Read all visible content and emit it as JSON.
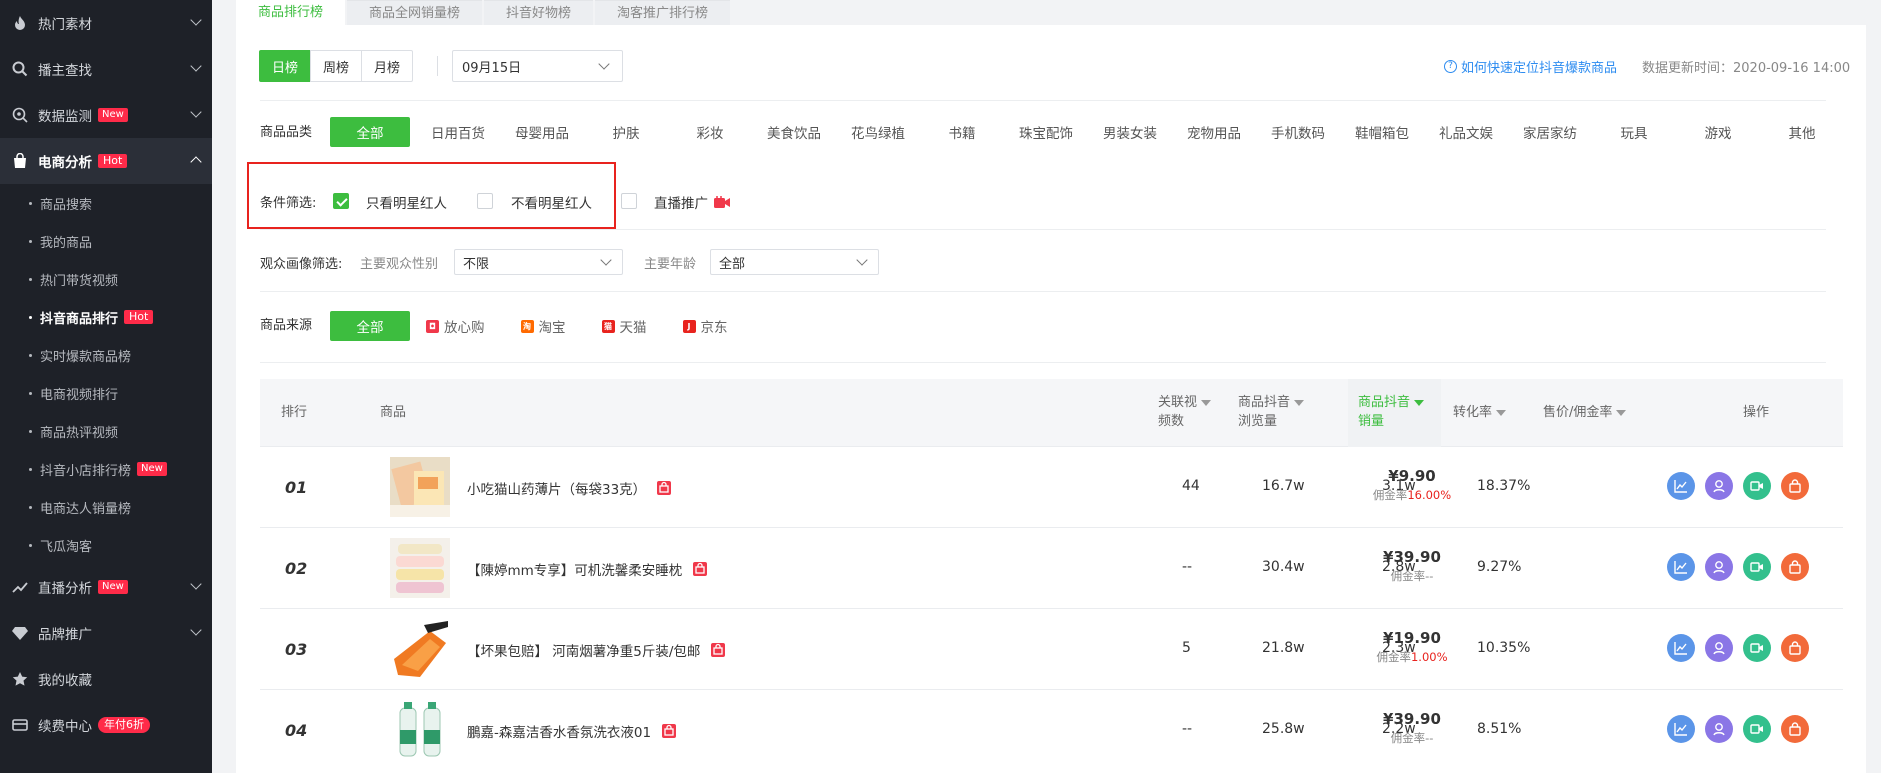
{
  "sidebar": {
    "items": [
      {
        "label": "热门素材",
        "icon": "fire-icon"
      },
      {
        "label": "播主查找",
        "icon": "search-icon"
      },
      {
        "label": "数据监测",
        "icon": "monitor-icon",
        "badge": "New"
      },
      {
        "label": "电商分析",
        "icon": "shopping-bag-icon",
        "badge": "Hot"
      },
      {
        "label": "直播分析",
        "icon": "trend-icon",
        "badge": "New"
      },
      {
        "label": "品牌推广",
        "icon": "diamond-icon"
      },
      {
        "label": "我的收藏",
        "icon": "star-icon"
      },
      {
        "label": "续费中心",
        "icon": "card-icon",
        "badge": "年付6折"
      }
    ],
    "sub_items": [
      {
        "label": "商品搜索"
      },
      {
        "label": "我的商品"
      },
      {
        "label": "热门带货视频"
      },
      {
        "label": "抖音商品排行",
        "badge": "Hot"
      },
      {
        "label": "实时爆款商品榜"
      },
      {
        "label": "电商视频排行"
      },
      {
        "label": "商品热评视频"
      },
      {
        "label": "抖音小店排行榜",
        "badge": "New"
      },
      {
        "label": "电商达人销量榜"
      },
      {
        "label": "飞瓜淘客"
      }
    ]
  },
  "tabs": [
    "商品排行榜",
    "商品全网销量榜",
    "抖音好物榜",
    "淘客推广排行榜"
  ],
  "period_buttons": [
    "日榜",
    "周榜",
    "月榜"
  ],
  "date_value": "09月15日",
  "help_link": "如何快速定位抖音爆款商品",
  "update_time": "数据更新时间：2020-09-16 14:00",
  "category": {
    "label": "商品品类",
    "items": [
      "全部",
      "日用百货",
      "母婴用品",
      "护肤",
      "彩妆",
      "美食饮品",
      "花鸟绿植",
      "书籍",
      "珠宝配饰",
      "男装女装",
      "宠物用品",
      "手机数码",
      "鞋帽箱包",
      "礼品文娱",
      "家居家纺",
      "玩具",
      "游戏",
      "其他"
    ]
  },
  "conditions": {
    "label": "条件筛选:",
    "options": [
      {
        "label": "只看明星红人",
        "checked": true
      },
      {
        "label": "不看明星红人",
        "checked": false
      },
      {
        "label": "直播推广",
        "checked": false
      }
    ]
  },
  "audience": {
    "label": "观众画像筛选:",
    "gender_label": "主要观众性别",
    "gender_value": "不限",
    "age_label": "主要年龄",
    "age_value": "全部"
  },
  "source": {
    "label": "商品来源",
    "items": [
      {
        "label": "全部"
      },
      {
        "label": "放心购",
        "color": "#f0384a"
      },
      {
        "label": "淘宝",
        "color": "#ff6a00"
      },
      {
        "label": "天猫",
        "color": "#e8231e"
      },
      {
        "label": "京东",
        "color": "#e8231e"
      }
    ]
  },
  "table": {
    "headers": {
      "rank": "排行",
      "product": "商品",
      "videos_line1": "关联视",
      "videos_line2": "频数",
      "views_line1": "商品抖音",
      "views_line2": "浏览量",
      "sales_line1": "商品抖音",
      "sales_line2": "销量",
      "conversion": "转化率",
      "price": "售价/佣金率",
      "actions": "操作"
    },
    "commission_prefix": "佣金率",
    "rows": [
      {
        "rank": "01",
        "name": "小吃猫山药薄片（每袋33克）",
        "videos": "44",
        "views": "16.7w",
        "sales": "3.1w",
        "conversion": "18.37%",
        "price": "¥9.90",
        "commission": "16.00%"
      },
      {
        "rank": "02",
        "name": "【陳婷mm专享】可机洗馨柔安睡枕",
        "videos": "--",
        "views": "30.4w",
        "sales": "2.8w",
        "conversion": "9.27%",
        "price": "¥39.90",
        "commission": "--"
      },
      {
        "rank": "03",
        "name": "【坏果包赔】 河南烟薯净重5斤装/包邮",
        "videos": "5",
        "views": "21.8w",
        "sales": "2.3w",
        "conversion": "10.35%",
        "price": "¥19.90",
        "commission": "1.00%"
      },
      {
        "rank": "04",
        "name": "鵬嘉-森嘉洁香水香氛洗衣液01",
        "videos": "--",
        "views": "25.8w",
        "sales": "2.2w",
        "conversion": "8.51%",
        "price": "¥39.90",
        "commission": "--"
      }
    ]
  },
  "colors": {
    "accent": "#3dbd3f",
    "sidebar_bg": "#1e2128",
    "badge": "#ff2b49",
    "highlight_box": "#e8231e",
    "link": "#2d8cf0"
  }
}
